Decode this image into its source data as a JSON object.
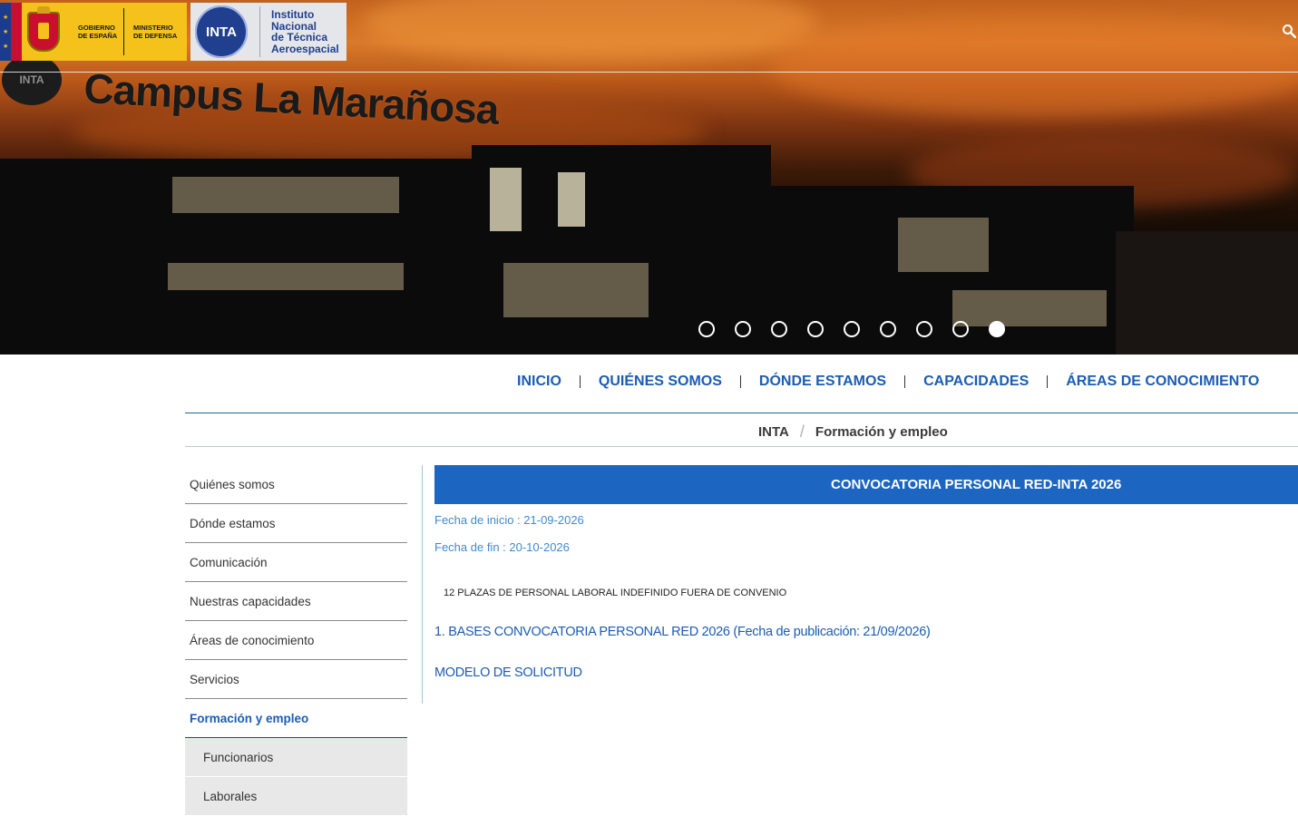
{
  "header": {
    "gob_line1": "GOBIERNO",
    "gob_line2": "DE ESPAÑA",
    "mde_line1": "MINISTERIO",
    "mde_line2": "DE DEFENSA",
    "inta_acronym": "INTA",
    "inta_name_line1": "Instituto",
    "inta_name_line2": "Nacional",
    "inta_name_line3": "de Técnica",
    "inta_name_line4": "Aeroespacial",
    "search_icon": "search-icon"
  },
  "hero": {
    "sign_text": "Campus La Marañosa",
    "badge_text": "INTA",
    "slides_count": 9,
    "active_slide": 9
  },
  "nav": {
    "items": [
      "INICIO",
      "QUIÉNES SOMOS",
      "DÓNDE ESTAMOS",
      "CAPACIDADES",
      "ÁREAS DE CONOCIMIENTO"
    ]
  },
  "breadcrumb": {
    "root": "INTA",
    "current": "Formación y empleo"
  },
  "sidebar": {
    "items": [
      "Quiénes somos",
      "Dónde estamos",
      "Comunicación",
      "Nuestras capacidades",
      "Áreas de conocimiento",
      "Servicios",
      "Formación y empleo"
    ],
    "active": "Formación y empleo",
    "subitems": [
      "Funcionarios",
      "Laborales"
    ]
  },
  "main": {
    "title": "CONVOCATORIA PERSONAL RED-INTA 2026",
    "fecha_inicio": "Fecha de inicio : 21-09-2026",
    "fecha_fin": "Fecha de fin : 20-10-2026",
    "plazas": "12 PLAZAS DE PERSONAL LABORAL INDEFINIDO FUERA DE CONVENIO",
    "link_bases": "1. BASES CONVOCATORIA PERSONAL RED 2026 (Fecha de publicación: 21/09/2026)",
    "link_modelo": "MODELO DE SOLICITUD"
  },
  "colors": {
    "brand_blue": "#1c66c2",
    "link_blue": "#1c5cb3",
    "meta_blue": "#3f8ad1",
    "gob_yellow": "#f4c21a",
    "inta_blue": "#213f8f"
  }
}
